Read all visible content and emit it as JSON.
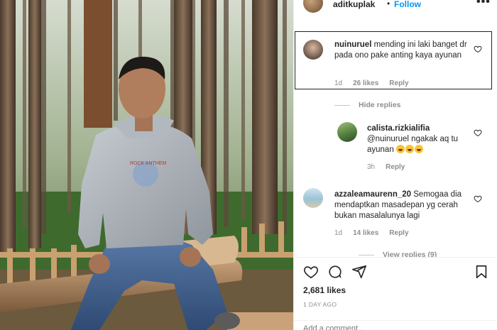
{
  "post": {
    "author": "aditkuplak",
    "separator": "•",
    "follow_label": "Follow",
    "more_label": "•••"
  },
  "comments": [
    {
      "username": "nuinuruel",
      "text": "mending ini laki banget dr pada ono pake anting kaya ayunan",
      "time": "1d",
      "likes": "26 likes",
      "reply_label": "Reply",
      "highlighted": true
    },
    {
      "username": "calista.rizkialifia",
      "text": "@nuinuruel ngakak aq tu ayunan",
      "emoji_count": 3,
      "time": "3h",
      "reply_label": "Reply",
      "is_reply": true
    },
    {
      "username": "azzaleamaurenn_20",
      "text": "Semogaa dia mendaptkan masadepan yg cerah bukan masalalunya lagi",
      "time": "1d",
      "likes": "14 likes",
      "reply_label": "Reply"
    }
  ],
  "hide_replies_label": "Hide replies",
  "view_replies_label": "View replies (9)",
  "actions": {
    "icons": [
      "heart-icon",
      "comment-icon",
      "share-icon",
      "bookmark-icon"
    ]
  },
  "likes_label": "2,681 likes",
  "date_label": "1 DAY AGO",
  "add_comment_placeholder": "Add a comment...",
  "colors": {
    "follow_blue": "#0095f6",
    "meta_gray": "#8e8e8e",
    "text_dark": "#262626"
  }
}
